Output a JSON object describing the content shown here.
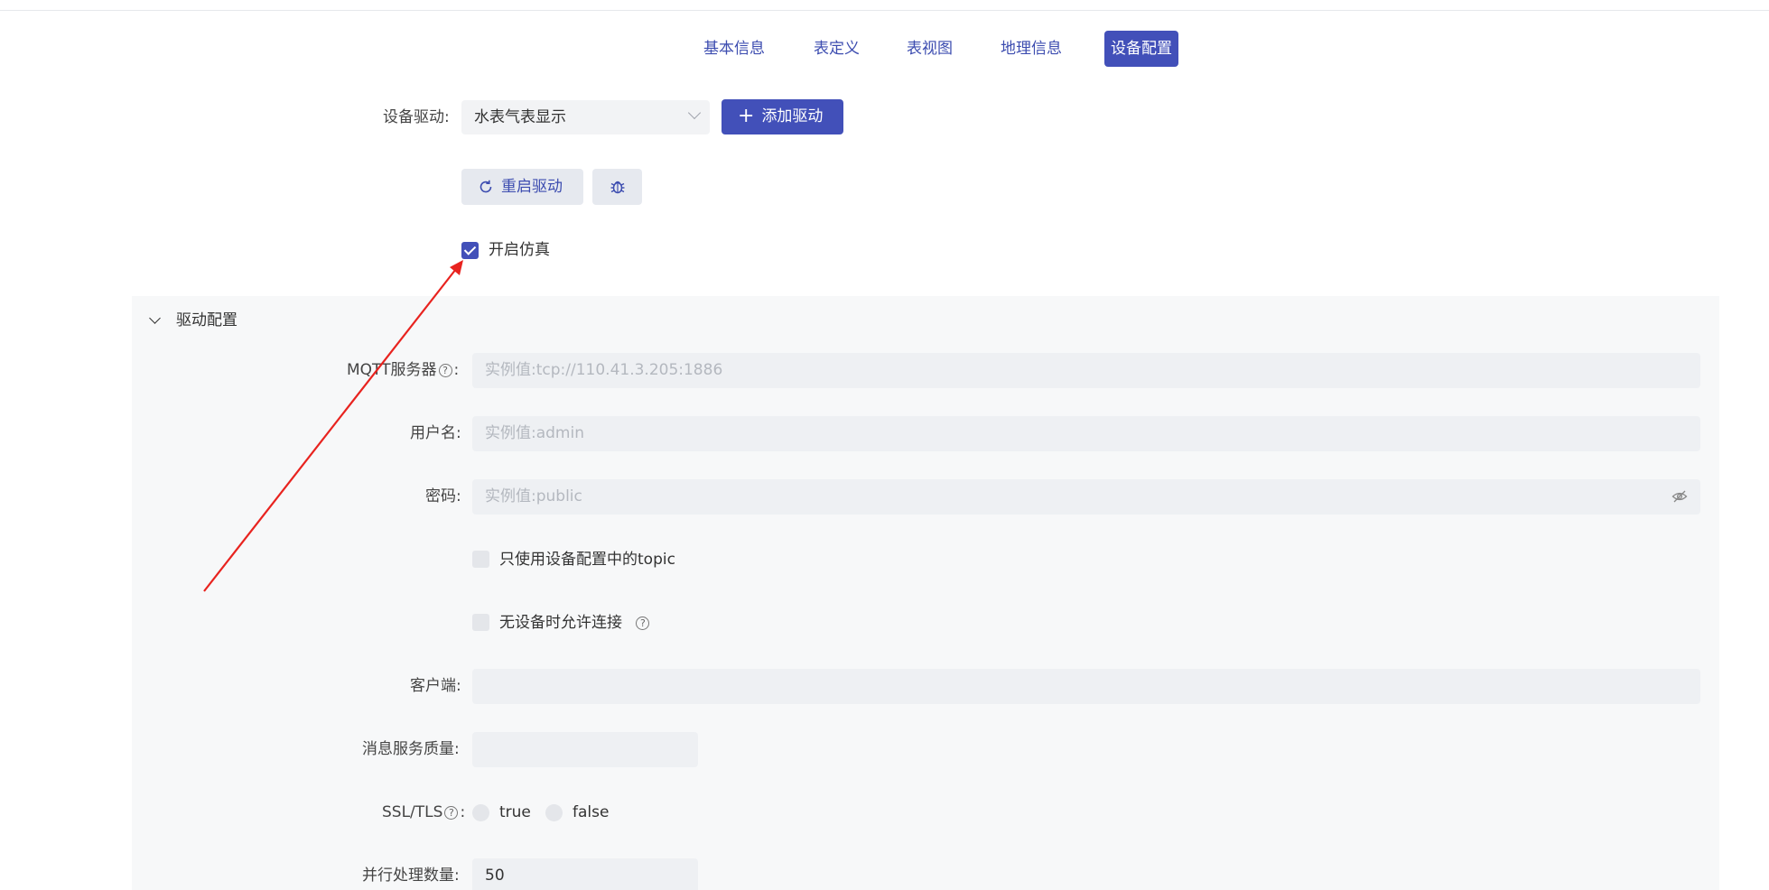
{
  "tabs": [
    {
      "label": "基本信息"
    },
    {
      "label": "表定义"
    },
    {
      "label": "表视图"
    },
    {
      "label": "地理信息"
    },
    {
      "label": "设备配置",
      "active": true
    }
  ],
  "device_driver": {
    "label": "设备驱动:",
    "selected": "水表气表显示",
    "add_button": "添加驱动",
    "restart_button": "重启驱动",
    "debug_icon": "bug-icon"
  },
  "simulation": {
    "label": "开启仿真",
    "checked": true
  },
  "driver_config": {
    "title": "驱动配置",
    "mqtt_server": {
      "label": "MQTT服务器",
      "colon": ":",
      "placeholder": "实例值:tcp://110.41.3.205:1886"
    },
    "username": {
      "label": "用户名:",
      "placeholder": "实例值:admin"
    },
    "password": {
      "label": "密码:",
      "placeholder": "实例值:public"
    },
    "only_topic": {
      "label": "只使用设备配置中的topic",
      "checked": false
    },
    "allow_no_device": {
      "label": "无设备时允许连接",
      "checked": false
    },
    "client": {
      "label": "客户端:",
      "value": ""
    },
    "qos": {
      "label": "消息服务质量:",
      "value": ""
    },
    "ssl": {
      "label": "SSL/TLS",
      "colon": ":",
      "options": [
        "true",
        "false"
      ]
    },
    "parallel": {
      "label": "并行处理数量:",
      "value": "50"
    }
  },
  "colors": {
    "accent": "#4250b9",
    "annotation_arrow": "#e8231f"
  }
}
